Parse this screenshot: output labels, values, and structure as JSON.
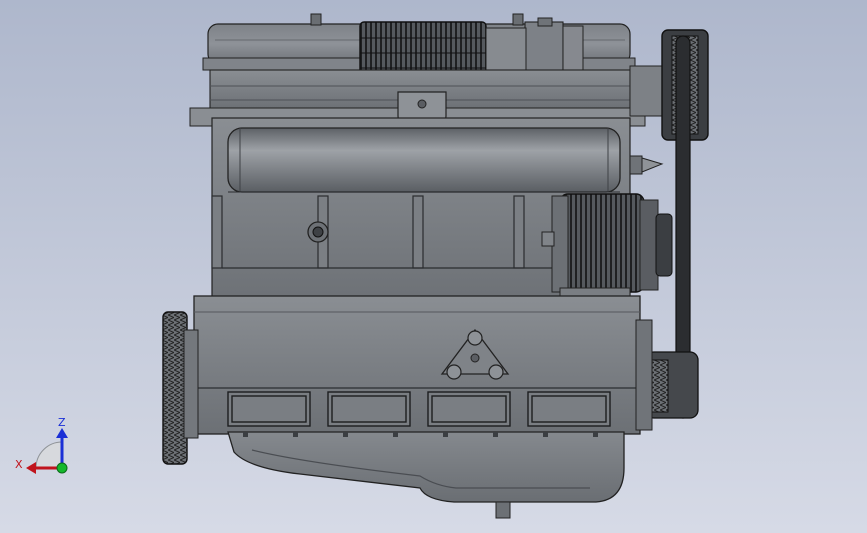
{
  "view": {
    "model": "engine-assembly",
    "colors": {
      "background_top": "#aeb7cc",
      "background_bottom": "#d6dae6",
      "metal_light": "#8e9298",
      "metal_mid": "#6f7378",
      "metal_dark": "#3e4145",
      "outline": "#1c1d1f"
    }
  },
  "triad": {
    "z_label": "Z",
    "x_label": "X",
    "colors": {
      "x": "#c0141c",
      "y": "#14b82c",
      "z": "#1a2fd6"
    }
  }
}
